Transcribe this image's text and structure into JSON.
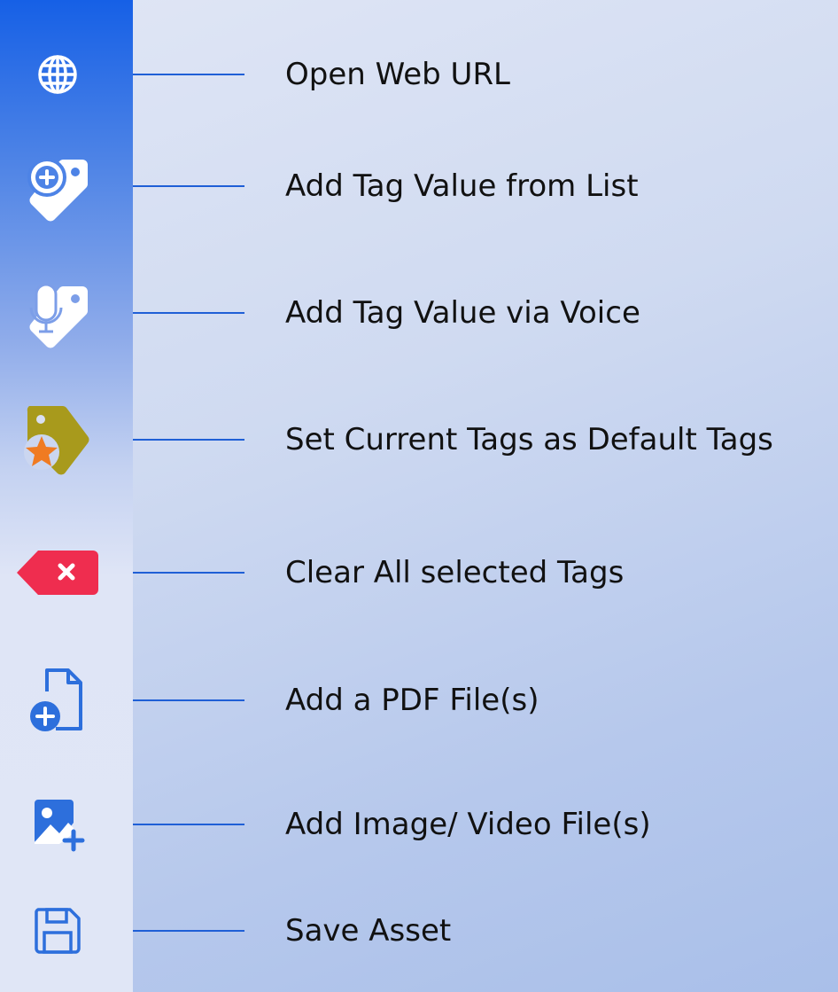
{
  "toolbar": {
    "items": [
      {
        "icon": "globe-icon",
        "label": "Open Web URL"
      },
      {
        "icon": "tag-add-icon",
        "label": "Add Tag Value from List"
      },
      {
        "icon": "tag-voice-icon",
        "label": "Add Tag Value via Voice"
      },
      {
        "icon": "tag-star-icon",
        "label": "Set Current Tags as Default Tags"
      },
      {
        "icon": "tag-clear-icon",
        "label": "Clear All selected Tags"
      },
      {
        "icon": "file-add-icon",
        "label": "Add a PDF File(s)"
      },
      {
        "icon": "image-add-icon",
        "label": "Add Image/ Video File(s)"
      },
      {
        "icon": "save-icon",
        "label": "Save Asset"
      }
    ]
  },
  "colors": {
    "toolbar_top": "#1660e6",
    "toolbar_bottom": "#e0e6f6",
    "leader_line": "#1f5fd6",
    "icon_blue": "#2d6fdc",
    "tag_olive": "#a89a1c",
    "star_orange": "#f07b22",
    "clear_red": "#ef2d4f"
  }
}
